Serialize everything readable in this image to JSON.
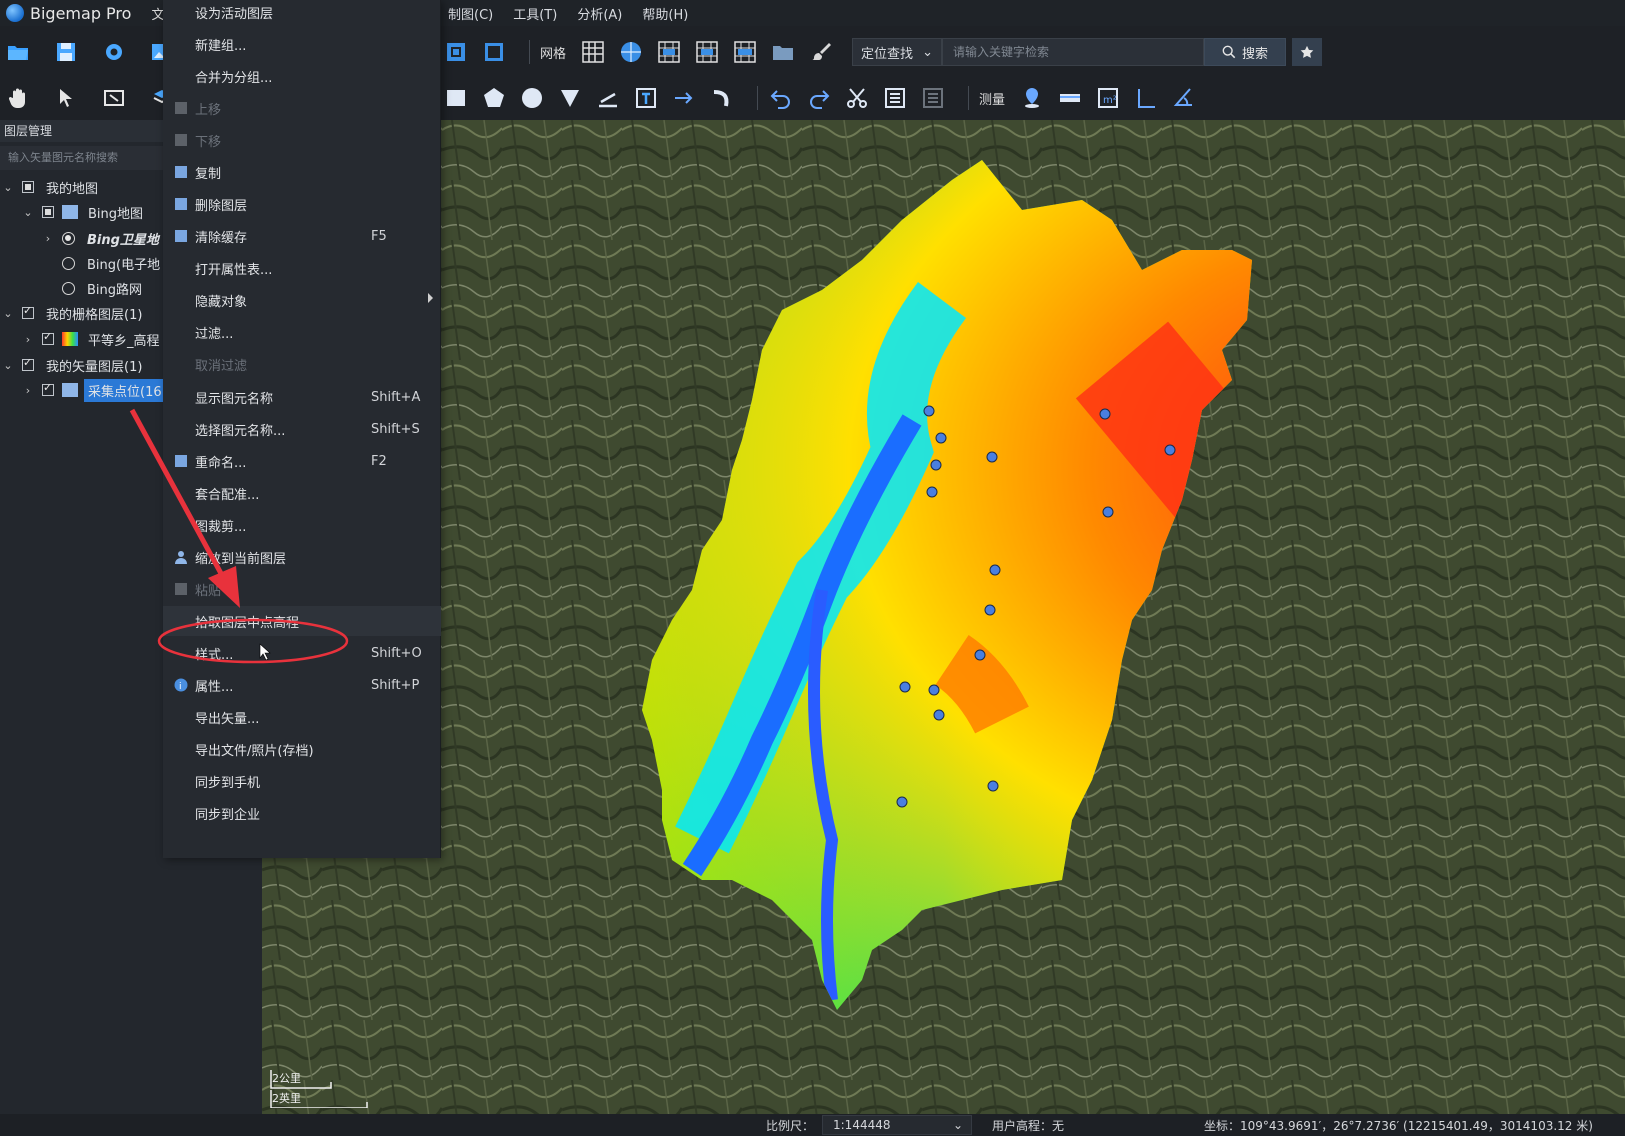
{
  "app": {
    "title": "Bigemap Pro",
    "file_menu": "文件"
  },
  "menubar": [
    "制图(C)",
    "工具(T)",
    "分析(A)",
    "帮助(H)"
  ],
  "toolbar": {
    "grid_label": "网格",
    "locate_label": "定位查找",
    "search_placeholder": "请输入关键字检索",
    "search_button": "搜索",
    "measure_label": "测量"
  },
  "layer_panel": {
    "header": "图层管理",
    "search_placeholder": "输入矢量图元名称搜索",
    "tree": [
      {
        "label": "我的地图",
        "level": 0,
        "control": "square",
        "expanded": true
      },
      {
        "label": "Bing地图",
        "level": 1,
        "control": "square",
        "expanded": true
      },
      {
        "label": "Bing卫星地",
        "level": 2,
        "control": "radio-on",
        "expanded": false
      },
      {
        "label": "Bing(电子地",
        "level": 2,
        "control": "radio"
      },
      {
        "label": "Bing路网",
        "level": 2,
        "control": "radio"
      },
      {
        "label": "我的栅格图层(1)",
        "level": 0,
        "control": "checked",
        "expanded": true
      },
      {
        "label": "平等乡_高程",
        "level": 1,
        "control": "checked",
        "expanded": false
      },
      {
        "label": "我的矢量图层(1)",
        "level": 0,
        "control": "checked",
        "expanded": true
      },
      {
        "label": "采集点位(16",
        "level": 1,
        "control": "checked",
        "expanded": false,
        "selected": true
      }
    ]
  },
  "context_menu": [
    {
      "label": "设为活动图层",
      "shortcut": "",
      "disabled": false
    },
    {
      "label": "新建组...",
      "shortcut": "",
      "disabled": false
    },
    {
      "label": "合并为分组...",
      "shortcut": "",
      "disabled": false
    },
    {
      "label": "上移",
      "shortcut": "",
      "disabled": true
    },
    {
      "label": "下移",
      "shortcut": "",
      "disabled": true
    },
    {
      "label": "复制",
      "shortcut": "",
      "disabled": false
    },
    {
      "label": "删除图层",
      "shortcut": "",
      "disabled": false
    },
    {
      "label": "清除缓存",
      "shortcut": "F5",
      "disabled": false
    },
    {
      "label": "打开属性表...",
      "shortcut": "",
      "disabled": false
    },
    {
      "label": "隐藏对象",
      "shortcut": "",
      "disabled": false,
      "submenu": true
    },
    {
      "label": "过滤...",
      "shortcut": "",
      "disabled": false
    },
    {
      "label": "取消过滤",
      "shortcut": "",
      "disabled": true
    },
    {
      "label": "显示图元名称",
      "shortcut": "Shift+A",
      "disabled": false
    },
    {
      "label": "选择图元名称...",
      "shortcut": "Shift+S",
      "disabled": false
    },
    {
      "label": "重命名...",
      "shortcut": "F2",
      "disabled": false
    },
    {
      "label": "套合配准...",
      "shortcut": "",
      "disabled": false
    },
    {
      "label": "图裁剪...",
      "shortcut": "",
      "disabled": false
    },
    {
      "label": "缩放到当前图层",
      "shortcut": "",
      "disabled": false
    },
    {
      "label": "粘贴",
      "shortcut": "",
      "disabled": true
    },
    {
      "label": "拾取图层中点高程",
      "shortcut": "",
      "disabled": false,
      "highlighted": true
    },
    {
      "label": "样式...",
      "shortcut": "Shift+O",
      "disabled": false
    },
    {
      "label": "属性...",
      "shortcut": "Shift+P",
      "disabled": false
    },
    {
      "label": "导出矢量...",
      "shortcut": "",
      "disabled": false
    },
    {
      "label": "导出文件/照片(存档)",
      "shortcut": "",
      "disabled": false
    },
    {
      "label": "同步到手机",
      "shortcut": "",
      "disabled": false
    },
    {
      "label": "同步到企业",
      "shortcut": "",
      "disabled": false
    }
  ],
  "map": {
    "scale_bar": {
      "top": "2公里",
      "bottom": "2英里"
    },
    "points_count_label": "采集点位"
  },
  "statusbar": {
    "scale_label": "比例尺：",
    "scale_value": "1:144448",
    "elevation": "用户高程：无",
    "coordinates": "坐标：109°43.9691′，26°7.2736′  (12215401.49，3014103.12 米)"
  },
  "colors": {
    "selection": "#2b79d6",
    "annotation": "#e8323c",
    "point": "#4a7fe0"
  }
}
